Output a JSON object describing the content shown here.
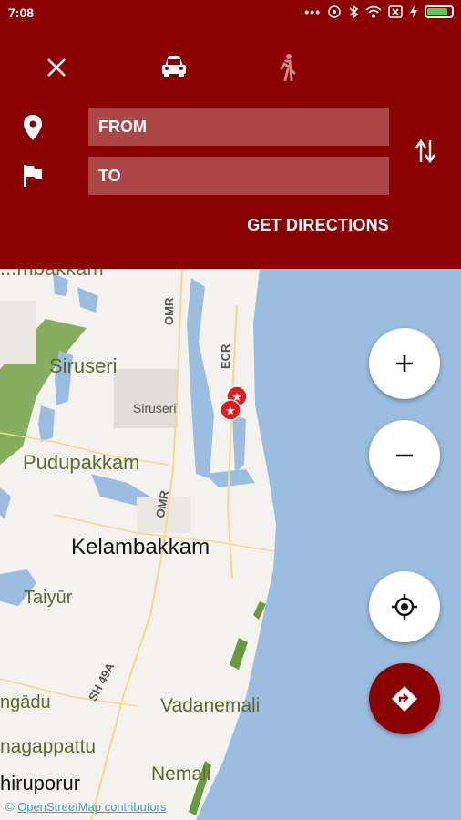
{
  "status_bar": {
    "time": "7:08",
    "indicators": [
      "more-dots-icon",
      "hotspot-icon",
      "bluetooth-icon",
      "wifi-icon",
      "sim-x-icon",
      "charging-icon",
      "battery-icon"
    ]
  },
  "header": {
    "modes": [
      "close-icon",
      "car-icon",
      "walk-icon"
    ],
    "from_placeholder": "FROM",
    "to_placeholder": "TO",
    "get_directions": "GET DIRECTIONS",
    "colors": {
      "primary": "#8b0000",
      "water": "#9bbee0",
      "park": "#7ea85a"
    }
  },
  "map": {
    "labels": [
      {
        "text": "...mbakkam"
      },
      {
        "text": "OMR"
      },
      {
        "text": "Siruseri"
      },
      {
        "text": "Siruseri"
      },
      {
        "text": "ECR"
      },
      {
        "text": "Pudupakkam"
      },
      {
        "text": "OMR"
      },
      {
        "text": "Kelambakkam"
      },
      {
        "text": "Taiyūr"
      },
      {
        "text": "SH 49A"
      },
      {
        "text": "ngādu"
      },
      {
        "text": "Vadanemali"
      },
      {
        "text": "nagappattu"
      },
      {
        "text": "Nemali"
      },
      {
        "text": "hiruporur"
      }
    ],
    "attribution_prefix": "© ",
    "attribution_link": "OpenStreetMap contributors",
    "controls": [
      "zoom-in",
      "zoom-out",
      "my-location",
      "directions"
    ]
  }
}
